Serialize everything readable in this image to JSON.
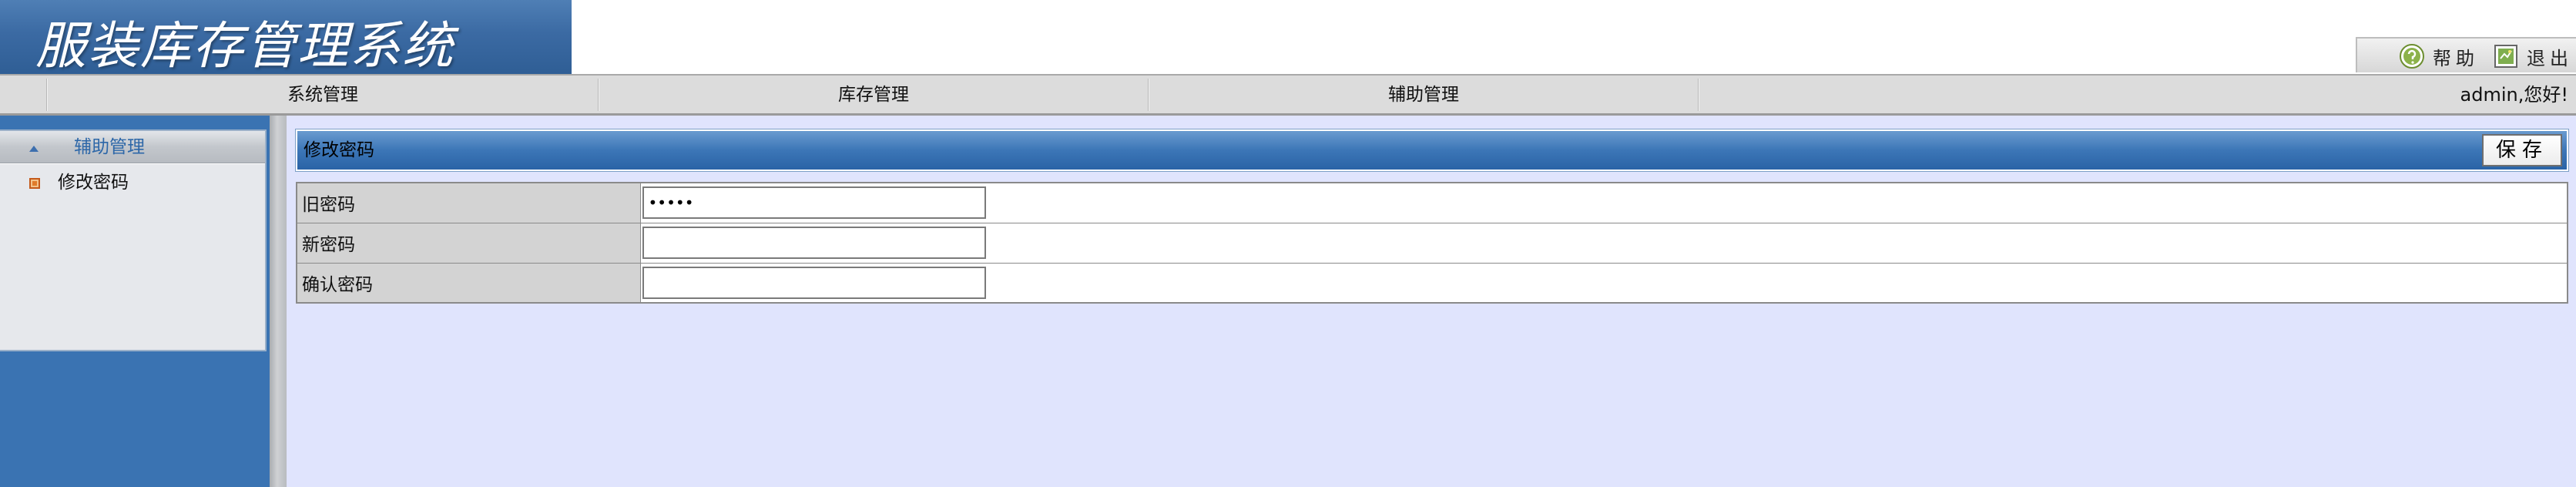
{
  "header": {
    "logo_title": "服装库存管理系统",
    "help_label": "帮助",
    "logout_label": "退出",
    "help_icon": "help-circle-icon",
    "logout_icon": "exit-icon"
  },
  "menubar": {
    "items": [
      {
        "label": "系统管理"
      },
      {
        "label": "库存管理"
      },
      {
        "label": "辅助管理"
      }
    ],
    "welcome": "admin,您好!"
  },
  "sidebar": {
    "title": "辅助管理",
    "items": [
      {
        "label": "修改密码",
        "icon": "bullet-square-icon"
      }
    ]
  },
  "form": {
    "title": "修改密码",
    "save_label": "保存",
    "fields": [
      {
        "label": "旧密码",
        "value": "•••••",
        "type": "password"
      },
      {
        "label": "新密码",
        "value": "",
        "type": "password"
      },
      {
        "label": "确认密码",
        "value": "",
        "type": "password"
      }
    ]
  },
  "colors": {
    "header_blue": "#3b6aa3",
    "sidebar_blue": "#3a73b2",
    "content_bg": "#e0e4fd",
    "menubar_bg": "#dcdcdc",
    "label_cell_bg": "#d3d3d3"
  }
}
